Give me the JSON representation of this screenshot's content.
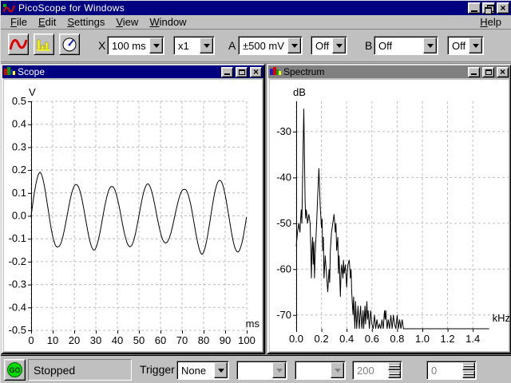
{
  "window": {
    "title": "PicoScope for Windows"
  },
  "menu": {
    "items": [
      "File",
      "Edit",
      "Settings",
      "View",
      "Window"
    ],
    "help": "Help"
  },
  "toolbar": {
    "scope_button_icon": "sine-wave-icon",
    "spectrum_button_icon": "bar-chart-icon",
    "meter_button_icon": "meter-dial-icon",
    "x_label": "X",
    "timebase": "100 ms",
    "x_multiplier": "x1",
    "a_label": "A",
    "a_range": "±500 mV",
    "a_mode": "Off",
    "b_label": "B",
    "b_range": "Off",
    "b_mode": "Off"
  },
  "scope_window": {
    "title": "Scope"
  },
  "spectrum_window": {
    "title": "Spectrum"
  },
  "status_bar": {
    "go_label": "GO",
    "status": "Stopped",
    "trigger_label": "Trigger",
    "trigger_mode": "None",
    "trigger_channel": "",
    "trigger_direction": "",
    "threshold": "200",
    "delay": "0"
  },
  "colors": {
    "active_title": "#000080",
    "inactive_title": "#808080",
    "chrome": "#c0c0c0",
    "grid": "#bdbdbd",
    "trace": "#000000",
    "go_green": "#00d800",
    "icon_red": "#e00000",
    "icon_yellow": "#ffff00",
    "icon_blue": "#2020c0"
  },
  "chart_data": [
    {
      "id": "scope",
      "type": "line",
      "title": "Scope",
      "xlabel": "ms",
      "ylabel": "V",
      "xlim": [
        0,
        100
      ],
      "ylim": [
        -0.5,
        0.5
      ],
      "xticks": [
        0,
        10,
        20,
        30,
        40,
        50,
        60,
        70,
        80,
        90,
        100
      ],
      "xtick_labels": [
        "0",
        "10",
        "20",
        "30",
        "40",
        "50",
        "60",
        "70",
        "80",
        "90",
        "100"
      ],
      "yticks": [
        0.5,
        0.4,
        0.3,
        0.2,
        0.1,
        0.0,
        -0.1,
        -0.2,
        -0.3,
        -0.4,
        -0.5
      ],
      "ytick_labels": [
        "0.5",
        "0.4",
        "0.3",
        "0.2",
        "0.1",
        "0.0",
        "-0.1",
        "-0.2",
        "-0.3",
        "-0.4",
        "-0.5"
      ],
      "grid": "dashed",
      "signal": {
        "kind": "amplitude-modulated sine",
        "frequency_hz": 60,
        "period_ms": 16.667,
        "duration_ms": 100,
        "amplitude_envelope": [
          [
            0,
            0.185
          ],
          [
            4.17,
            0.19
          ],
          [
            12.5,
            0.135
          ],
          [
            20.83,
            0.137
          ],
          [
            29.17,
            0.15
          ],
          [
            37.5,
            0.128
          ],
          [
            45.83,
            0.135
          ],
          [
            54.17,
            0.14
          ],
          [
            62.5,
            0.118
          ],
          [
            70.83,
            0.115
          ],
          [
            79.17,
            0.168
          ],
          [
            87.5,
            0.155
          ],
          [
            95.83,
            0.158
          ],
          [
            100,
            0.158
          ]
        ]
      }
    },
    {
      "id": "spectrum",
      "type": "line",
      "title": "Spectrum",
      "xlabel": "kHz",
      "ylabel": "dB",
      "xlim": [
        0,
        1.709
      ],
      "ylim": [
        -73,
        -23.4
      ],
      "xticks": [
        0.0,
        0.2,
        0.4,
        0.6,
        0.8,
        1.0,
        1.2,
        1.4
      ],
      "xtick_labels": [
        "0.0",
        "0.2",
        "0.4",
        "0.6",
        "0.8",
        "1.0",
        "1.2",
        "1.4"
      ],
      "yticks": [
        -30,
        -40,
        -50,
        -60,
        -70
      ],
      "ytick_labels": [
        "-30",
        "-40",
        "-50",
        "-60",
        "-70"
      ],
      "grid": "dashed",
      "points": [
        [
          0.0,
          -55
        ],
        [
          0.01,
          -52
        ],
        [
          0.02,
          -50
        ],
        [
          0.03,
          -52
        ],
        [
          0.035,
          -49
        ],
        [
          0.04,
          -47
        ],
        [
          0.045,
          -50
        ],
        [
          0.05,
          -41
        ],
        [
          0.06,
          -25
        ],
        [
          0.07,
          -45
        ],
        [
          0.075,
          -49
        ],
        [
          0.08,
          -47
        ],
        [
          0.09,
          -50
        ],
        [
          0.1,
          -48
        ],
        [
          0.11,
          -50
        ],
        [
          0.115,
          -55
        ],
        [
          0.12,
          -62
        ],
        [
          0.125,
          -56
        ],
        [
          0.13,
          -53
        ],
        [
          0.135,
          -59
        ],
        [
          0.14,
          -54
        ],
        [
          0.145,
          -62
        ],
        [
          0.15,
          -57
        ],
        [
          0.16,
          -51
        ],
        [
          0.17,
          -44
        ],
        [
          0.18,
          -38
        ],
        [
          0.19,
          -46
        ],
        [
          0.2,
          -51
        ],
        [
          0.205,
          -49
        ],
        [
          0.21,
          -56
        ],
        [
          0.215,
          -53
        ],
        [
          0.22,
          -62
        ],
        [
          0.23,
          -57
        ],
        [
          0.24,
          -61
        ],
        [
          0.25,
          -65
        ],
        [
          0.26,
          -60
        ],
        [
          0.265,
          -63
        ],
        [
          0.27,
          -56
        ],
        [
          0.28,
          -52
        ],
        [
          0.29,
          -50
        ],
        [
          0.3,
          -48
        ],
        [
          0.31,
          -52
        ],
        [
          0.315,
          -50
        ],
        [
          0.32,
          -56
        ],
        [
          0.33,
          -53
        ],
        [
          0.335,
          -61
        ],
        [
          0.34,
          -57
        ],
        [
          0.35,
          -66
        ],
        [
          0.355,
          -61
        ],
        [
          0.36,
          -59
        ],
        [
          0.37,
          -62
        ],
        [
          0.375,
          -58
        ],
        [
          0.38,
          -61
        ],
        [
          0.39,
          -59
        ],
        [
          0.4,
          -64
        ],
        [
          0.405,
          -61
        ],
        [
          0.41,
          -59
        ],
        [
          0.42,
          -58
        ],
        [
          0.43,
          -62
        ],
        [
          0.435,
          -60
        ],
        [
          0.44,
          -65
        ],
        [
          0.45,
          -70
        ],
        [
          0.455,
          -66
        ],
        [
          0.46,
          -70
        ],
        [
          0.465,
          -73
        ],
        [
          0.47,
          -67
        ],
        [
          0.48,
          -73
        ],
        [
          0.49,
          -68
        ],
        [
          0.5,
          -73
        ],
        [
          0.51,
          -68
        ],
        [
          0.52,
          -73
        ],
        [
          0.53,
          -69
        ],
        [
          0.535,
          -73
        ],
        [
          0.545,
          -68
        ],
        [
          0.55,
          -72
        ],
        [
          0.56,
          -67
        ],
        [
          0.565,
          -71
        ],
        [
          0.57,
          -69
        ],
        [
          0.58,
          -73
        ],
        [
          0.59,
          -69
        ],
        [
          0.6,
          -72
        ],
        [
          0.61,
          -73
        ],
        [
          0.62,
          -70
        ],
        [
          0.63,
          -73
        ],
        [
          0.64,
          -71
        ],
        [
          0.65,
          -73
        ],
        [
          0.66,
          -72
        ],
        [
          0.67,
          -73
        ],
        [
          0.68,
          -71
        ],
        [
          0.69,
          -73
        ],
        [
          0.7,
          -69
        ],
        [
          0.705,
          -71
        ],
        [
          0.71,
          -69
        ],
        [
          0.72,
          -73
        ],
        [
          0.73,
          -71
        ],
        [
          0.74,
          -73
        ],
        [
          0.75,
          -70
        ],
        [
          0.76,
          -73
        ],
        [
          0.77,
          -70
        ],
        [
          0.78,
          -72
        ],
        [
          0.79,
          -73
        ],
        [
          0.8,
          -70
        ],
        [
          0.81,
          -73
        ],
        [
          0.82,
          -71
        ],
        [
          0.83,
          -73
        ],
        [
          0.84,
          -71
        ],
        [
          0.85,
          -73
        ],
        [
          0.86,
          -73
        ],
        [
          0.9,
          -73
        ],
        [
          1.0,
          -73
        ],
        [
          1.1,
          -73
        ],
        [
          1.2,
          -73
        ],
        [
          1.3,
          -73
        ],
        [
          1.4,
          -73
        ],
        [
          1.5,
          -73
        ],
        [
          1.53,
          -73
        ]
      ]
    }
  ]
}
